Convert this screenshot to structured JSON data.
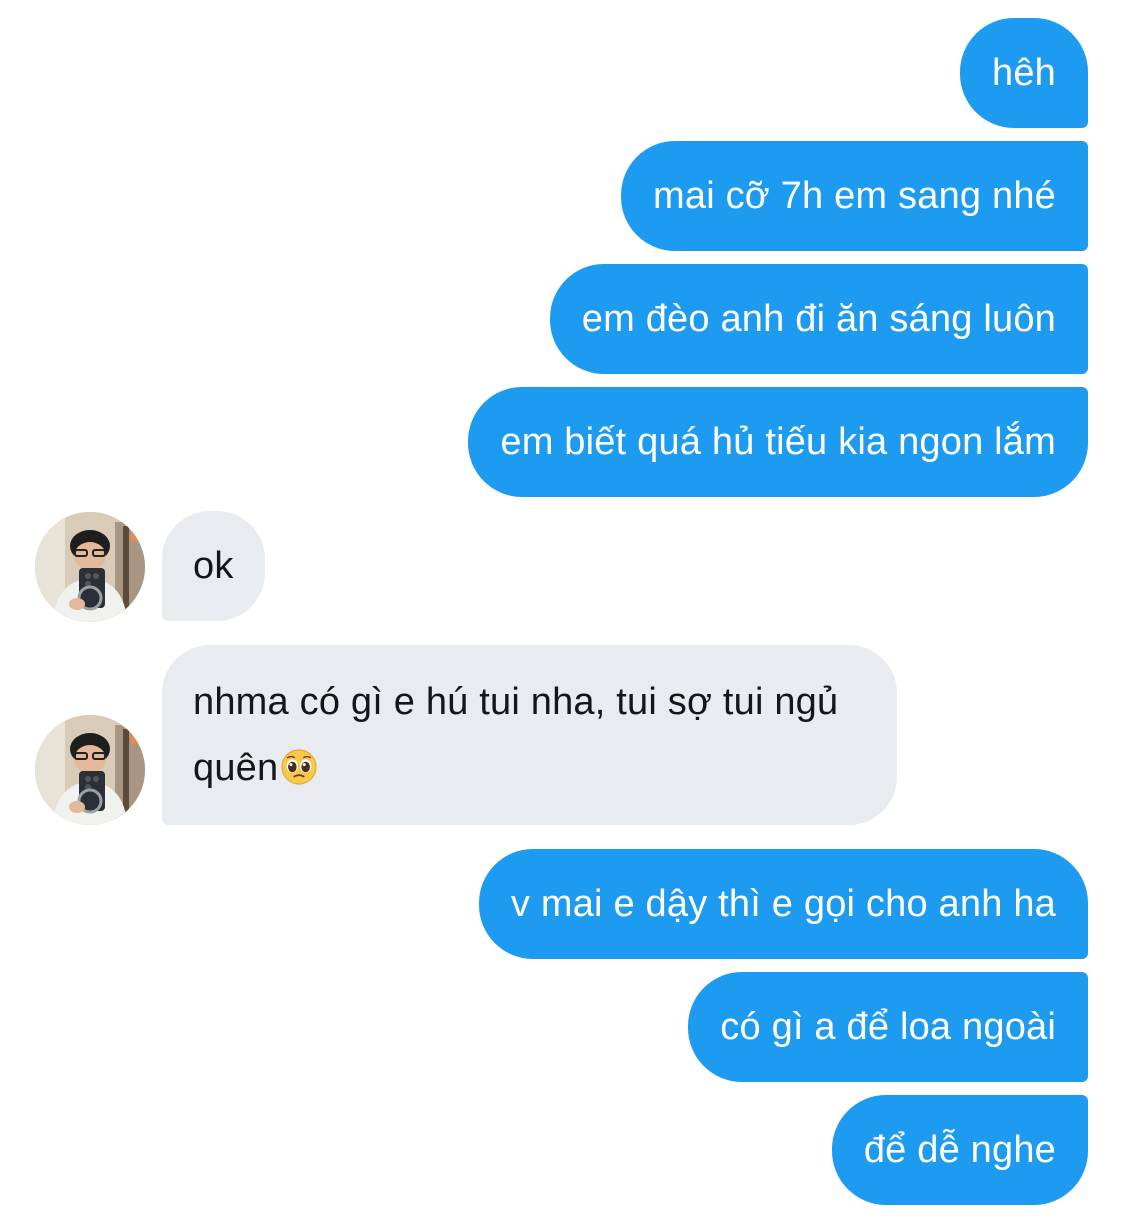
{
  "conversation": {
    "messages": [
      {
        "side": "out",
        "text": "hêh"
      },
      {
        "side": "out",
        "text": "mai cỡ 7h em sang nhé"
      },
      {
        "side": "out",
        "text": "em đèo anh đi ăn sáng luôn"
      },
      {
        "side": "out",
        "text": "em biết quá hủ tiếu kia ngon lắm"
      },
      {
        "side": "in",
        "text": "ok"
      },
      {
        "side": "in",
        "text": "nhma có gì e hú tui nha, tui sợ tui ngủ quên",
        "emoji": "🥺"
      },
      {
        "side": "out",
        "text": "v mai e dậy thì e gọi cho anh ha"
      },
      {
        "side": "out",
        "text": "có gì a để loa ngoài"
      },
      {
        "side": "out",
        "text": "để dễ nghe"
      }
    ]
  },
  "colors": {
    "outgoing_bubble": "#1d9bf0",
    "incoming_bubble": "#e8ecf0",
    "outgoing_text": "#ffffff",
    "incoming_text": "#14171a"
  },
  "icons": {
    "contact_avatar": "avatar-photo",
    "pleading_face": "pleading-face-emoji"
  }
}
